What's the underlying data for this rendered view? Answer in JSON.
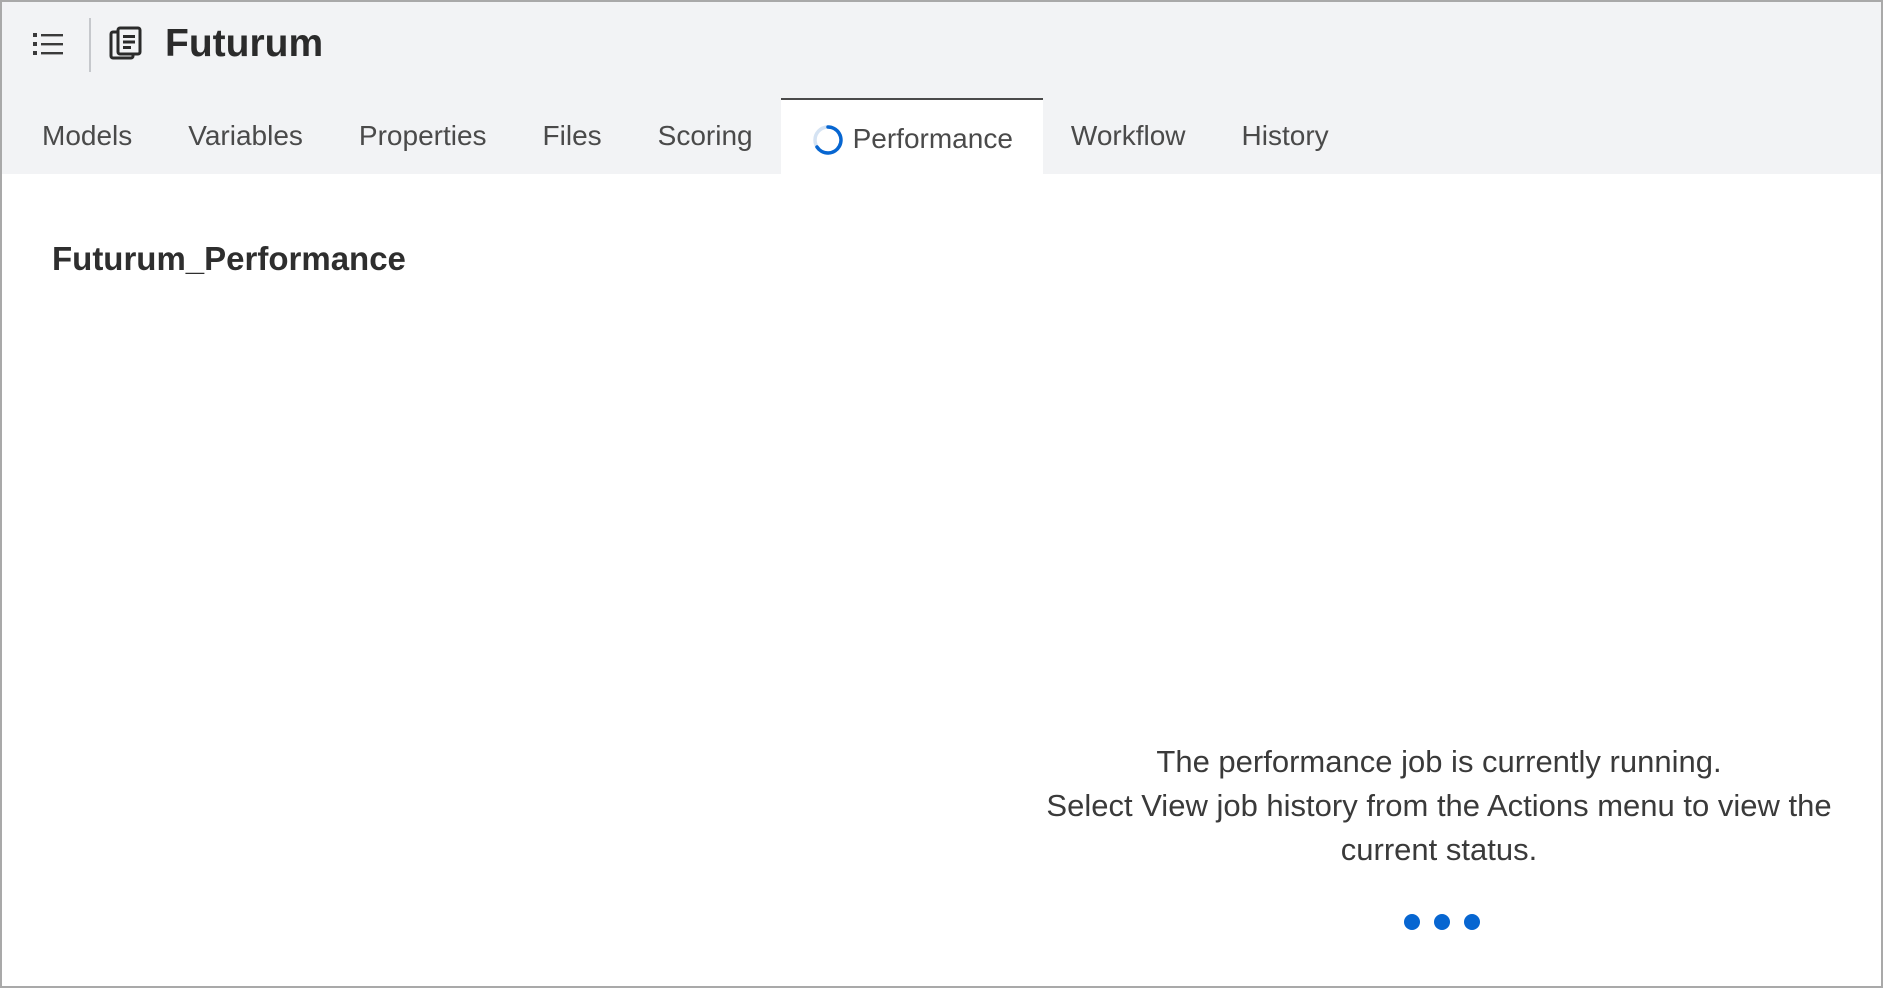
{
  "app": {
    "title": "Futurum",
    "menu_icon": "list-menu-icon",
    "app_icon": "project-icon"
  },
  "tabs": [
    {
      "label": "Models",
      "active": false
    },
    {
      "label": "Variables",
      "active": false
    },
    {
      "label": "Properties",
      "active": false
    },
    {
      "label": "Files",
      "active": false
    },
    {
      "label": "Scoring",
      "active": false
    },
    {
      "label": "Performance",
      "active": true,
      "icon": "loading-spinner-icon"
    },
    {
      "label": "Workflow",
      "active": false
    },
    {
      "label": "History",
      "active": false
    }
  ],
  "main": {
    "page_title": "Futurum_Performance",
    "status_line1": "The performance job is currently running.",
    "status_line2": "Select View job history from the Actions menu to view the",
    "status_line3": "current status."
  },
  "colors": {
    "header_bg": "#f2f3f5",
    "accent": "#0766d1",
    "spinner": "#0766d1"
  }
}
